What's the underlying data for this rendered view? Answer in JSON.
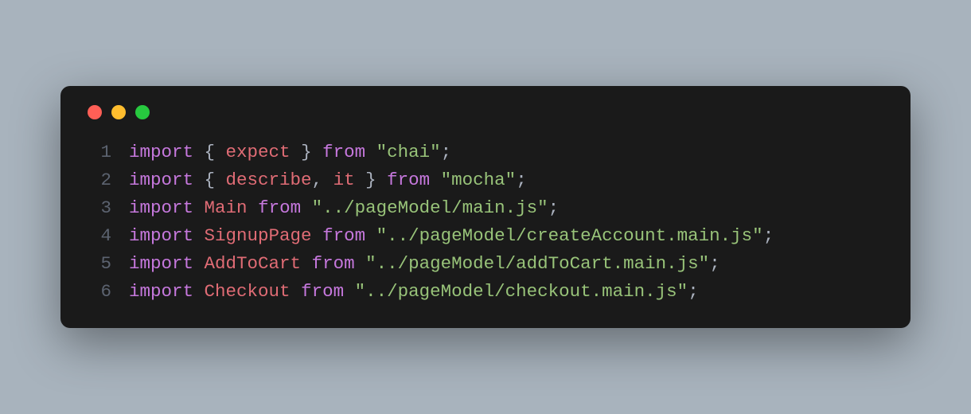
{
  "window": {
    "controls": {
      "close_color": "#ff5f56",
      "minimize_color": "#ffbd2e",
      "maximize_color": "#27c93f"
    }
  },
  "code": {
    "language": "javascript",
    "lines": [
      {
        "number": "1",
        "tokens": [
          {
            "type": "keyword",
            "text": "import"
          },
          {
            "type": "default",
            "text": " "
          },
          {
            "type": "punct",
            "text": "{ "
          },
          {
            "type": "ident",
            "text": "expect"
          },
          {
            "type": "punct",
            "text": " }"
          },
          {
            "type": "default",
            "text": " "
          },
          {
            "type": "keyword",
            "text": "from"
          },
          {
            "type": "default",
            "text": " "
          },
          {
            "type": "string",
            "text": "\"chai\""
          },
          {
            "type": "punct",
            "text": ";"
          }
        ]
      },
      {
        "number": "2",
        "tokens": [
          {
            "type": "keyword",
            "text": "import"
          },
          {
            "type": "default",
            "text": " "
          },
          {
            "type": "punct",
            "text": "{ "
          },
          {
            "type": "ident",
            "text": "describe"
          },
          {
            "type": "punct",
            "text": ", "
          },
          {
            "type": "ident",
            "text": "it"
          },
          {
            "type": "punct",
            "text": " }"
          },
          {
            "type": "default",
            "text": " "
          },
          {
            "type": "keyword",
            "text": "from"
          },
          {
            "type": "default",
            "text": " "
          },
          {
            "type": "string",
            "text": "\"mocha\""
          },
          {
            "type": "punct",
            "text": ";"
          }
        ]
      },
      {
        "number": "3",
        "tokens": [
          {
            "type": "keyword",
            "text": "import"
          },
          {
            "type": "default",
            "text": " "
          },
          {
            "type": "ident",
            "text": "Main"
          },
          {
            "type": "default",
            "text": " "
          },
          {
            "type": "keyword",
            "text": "from"
          },
          {
            "type": "default",
            "text": " "
          },
          {
            "type": "string",
            "text": "\"../pageModel/main.js\""
          },
          {
            "type": "punct",
            "text": ";"
          }
        ]
      },
      {
        "number": "4",
        "tokens": [
          {
            "type": "keyword",
            "text": "import"
          },
          {
            "type": "default",
            "text": " "
          },
          {
            "type": "ident",
            "text": "SignupPage"
          },
          {
            "type": "default",
            "text": " "
          },
          {
            "type": "keyword",
            "text": "from"
          },
          {
            "type": "default",
            "text": " "
          },
          {
            "type": "string",
            "text": "\"../pageModel/createAccount.main.js\""
          },
          {
            "type": "punct",
            "text": ";"
          }
        ]
      },
      {
        "number": "5",
        "tokens": [
          {
            "type": "keyword",
            "text": "import"
          },
          {
            "type": "default",
            "text": " "
          },
          {
            "type": "ident",
            "text": "AddToCart"
          },
          {
            "type": "default",
            "text": " "
          },
          {
            "type": "keyword",
            "text": "from"
          },
          {
            "type": "default",
            "text": " "
          },
          {
            "type": "string",
            "text": "\"../pageModel/addToCart.main.js\""
          },
          {
            "type": "punct",
            "text": ";"
          }
        ]
      },
      {
        "number": "6",
        "tokens": [
          {
            "type": "keyword",
            "text": "import"
          },
          {
            "type": "default",
            "text": " "
          },
          {
            "type": "ident",
            "text": "Checkout"
          },
          {
            "type": "default",
            "text": " "
          },
          {
            "type": "keyword",
            "text": "from"
          },
          {
            "type": "default",
            "text": " "
          },
          {
            "type": "string",
            "text": "\"../pageModel/checkout.main.js\""
          },
          {
            "type": "punct",
            "text": ";"
          }
        ]
      }
    ]
  }
}
